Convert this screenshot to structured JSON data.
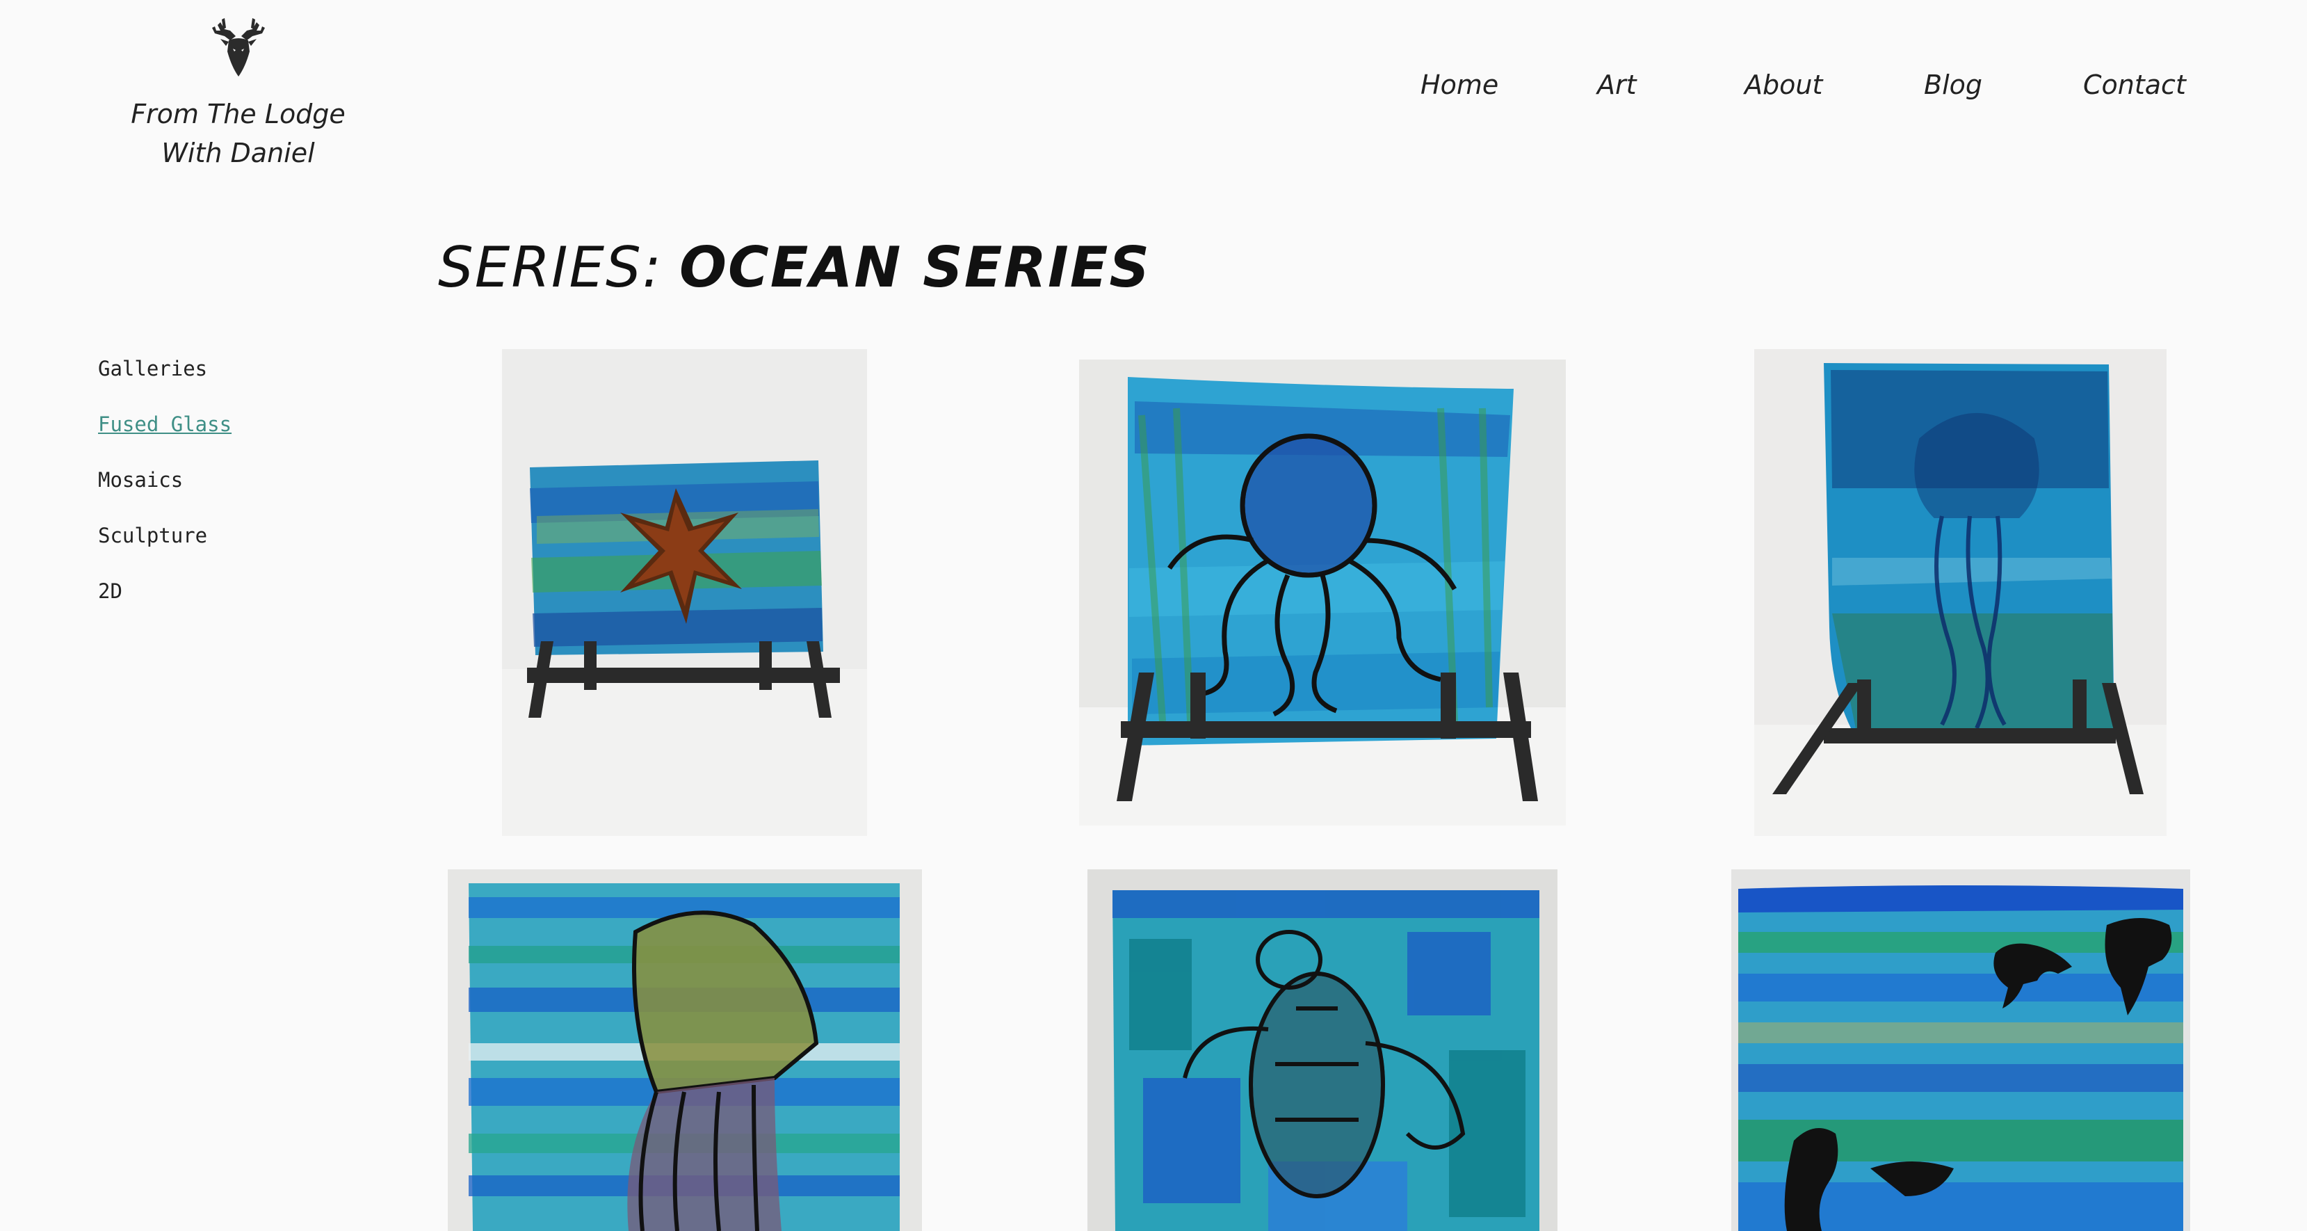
{
  "header": {
    "logo_line1": "From The Lodge",
    "logo_line2": "With Daniel"
  },
  "nav": {
    "items": [
      "Home",
      "Art",
      "About",
      "Blog",
      "Contact"
    ]
  },
  "title": {
    "prefix": "SERIES:",
    "main": "OCEAN SERIES"
  },
  "sidebar": {
    "items": [
      {
        "label": "Galleries",
        "active": false
      },
      {
        "label": "Fused Glass",
        "active": true
      },
      {
        "label": "Mosaics",
        "active": false
      },
      {
        "label": "Sculpture",
        "active": false
      },
      {
        "label": "2D",
        "active": false
      }
    ]
  },
  "gallery": {
    "tiles": [
      {
        "subject": "starfish-icon"
      },
      {
        "subject": "octopus-icon"
      },
      {
        "subject": "jellyfish-icon"
      },
      {
        "subject": "jellyfish-icon"
      },
      {
        "subject": "sea-turtle-icon"
      },
      {
        "subject": "dolphins-mermaid-icon"
      }
    ]
  },
  "colors": {
    "background": "#fafafa",
    "text": "#222222",
    "accent": "#3f8f86"
  }
}
